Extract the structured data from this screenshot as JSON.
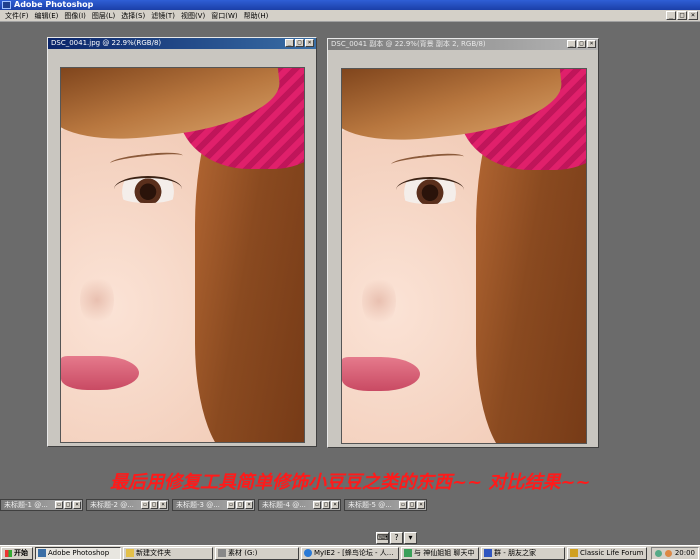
{
  "app": {
    "title": "Adobe Photoshop"
  },
  "menu": [
    "文件(F)",
    "编辑(E)",
    "图像(I)",
    "图层(L)",
    "选择(S)",
    "滤镜(T)",
    "视图(V)",
    "窗口(W)",
    "帮助(H)"
  ],
  "window_buttons": {
    "minimize": "_",
    "maximize": "□",
    "close": "×"
  },
  "documents": [
    {
      "title": "DSC_0041.jpg @ 22.9%(RGB/8)",
      "state": "active"
    },
    {
      "title": "DSC_0041 副本 @ 22.9%(背景 副本 2, RGB/8)",
      "state": "inactive"
    }
  ],
  "caption": "最后用修复工具简单修饰小豆豆之类的东西~~ 对比结果~~",
  "minimized_docs": [
    "未标题-1 @...",
    "未标题-2 @...",
    "未标题-3 @...",
    "未标题-4 @...",
    "未标题-5 @..."
  ],
  "tool_tray": [
    "⌨",
    "?",
    "▾"
  ],
  "taskbar": {
    "start_label": "开始",
    "tasks": [
      {
        "label": "Adobe Photoshop",
        "active": true
      },
      {
        "label": "新建文件夹",
        "active": false
      },
      {
        "label": "素材 (G:)",
        "active": false
      },
      {
        "label": "MyIE2 - [蜂鸟论坛 - 人...",
        "active": false
      },
      {
        "label": "与 神仙姐姐 聊天中",
        "active": false
      },
      {
        "label": "群 - 朋友之家",
        "active": false
      },
      {
        "label": "Classic Life Forum - 『人...",
        "active": false
      }
    ],
    "clock": "20:00"
  },
  "colors": {
    "caption": "#ff1a1a",
    "titlebar": "#1b3fa8",
    "desktop": "#6b6b6b"
  }
}
